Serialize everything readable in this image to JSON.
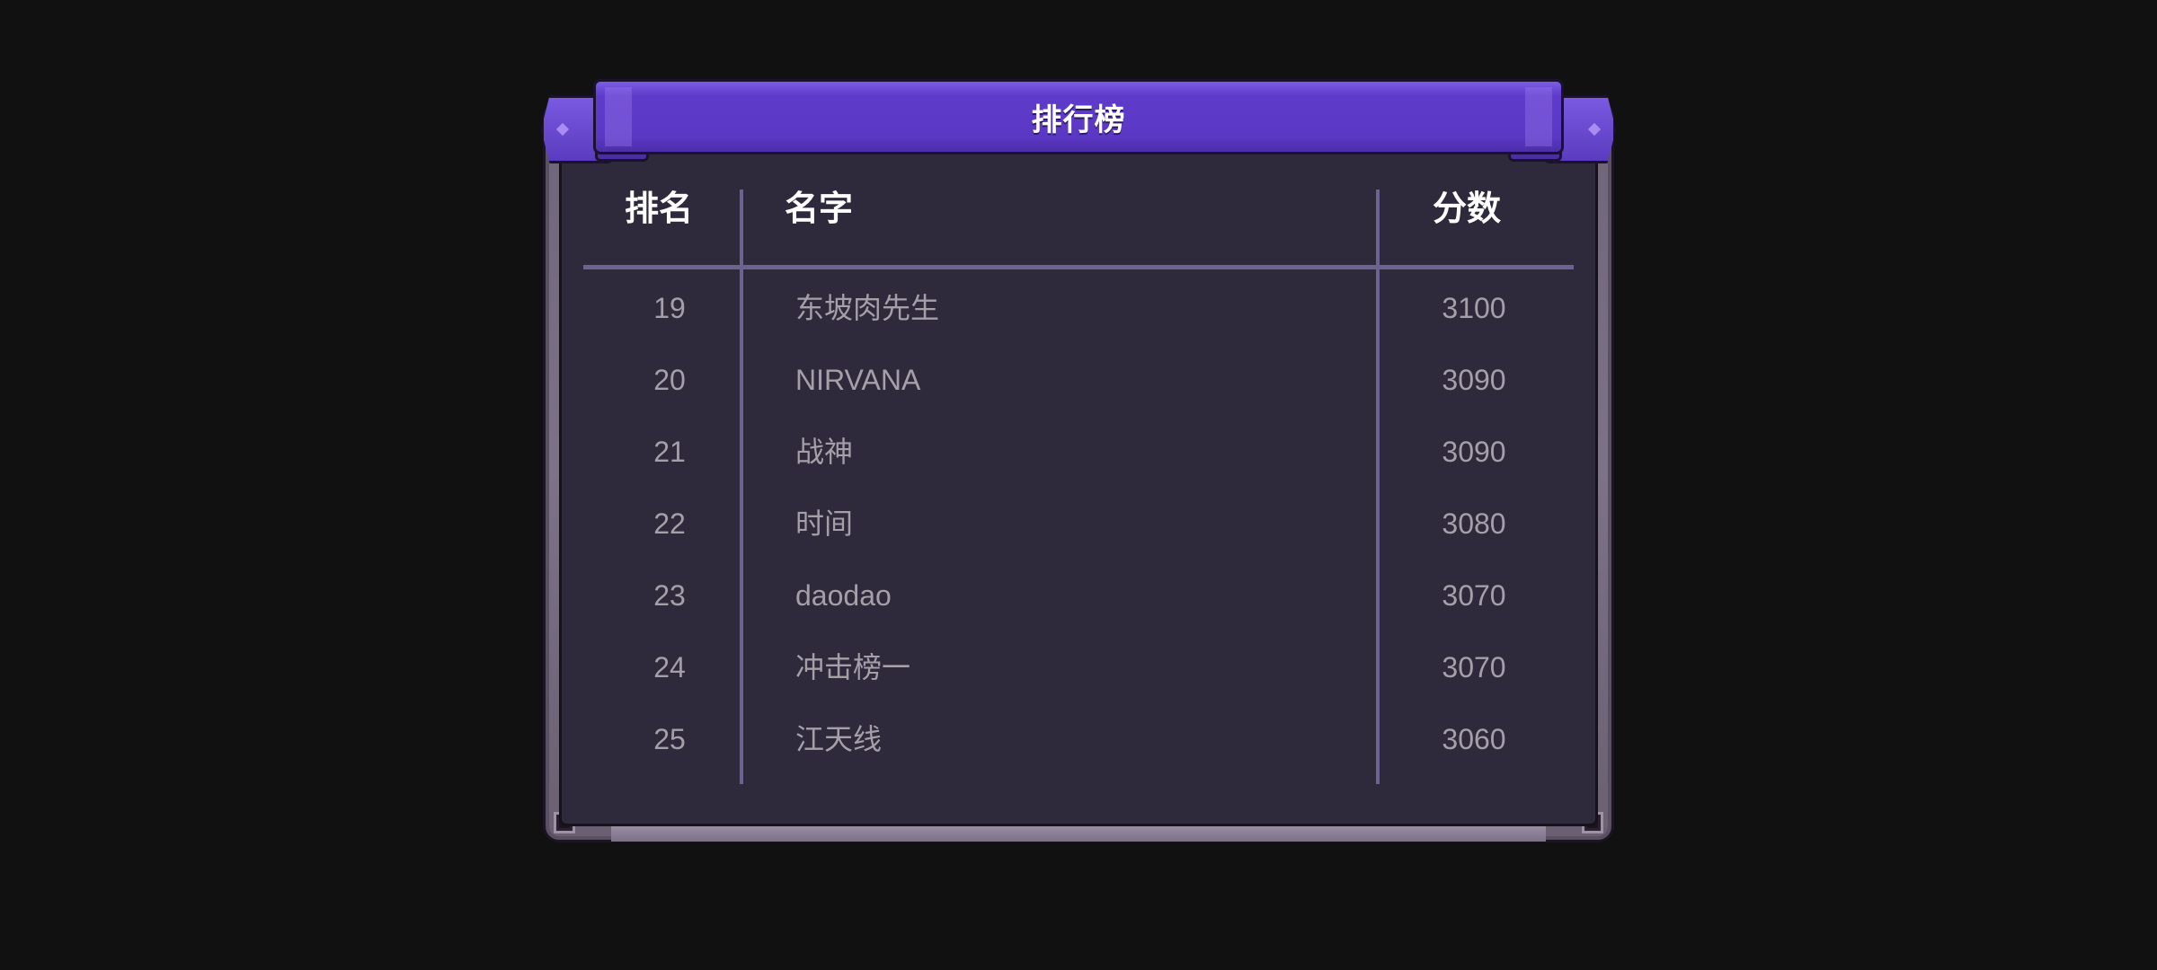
{
  "title": "排行榜",
  "headers": {
    "rank": "排名",
    "name": "名字",
    "score": "分数"
  },
  "rows": [
    {
      "rank": "19",
      "name": "东坡肉先生",
      "score": "3100"
    },
    {
      "rank": "20",
      "name": "NIRVANA",
      "score": "3090"
    },
    {
      "rank": "21",
      "name": "战神",
      "score": "3090"
    },
    {
      "rank": "22",
      "name": "时间",
      "score": "3080"
    },
    {
      "rank": "23",
      "name": "daodao",
      "score": "3070"
    },
    {
      "rank": "24",
      "name": "冲击榜一",
      "score": "3070"
    },
    {
      "rank": "25",
      "name": "江天线",
      "score": "3060"
    }
  ],
  "colors": {
    "ribbon": "#5f3bc9",
    "panel": "#2e2a3c",
    "frame": "#7d7286",
    "row_text": "#a59fa8",
    "divider": "#6d6391"
  }
}
